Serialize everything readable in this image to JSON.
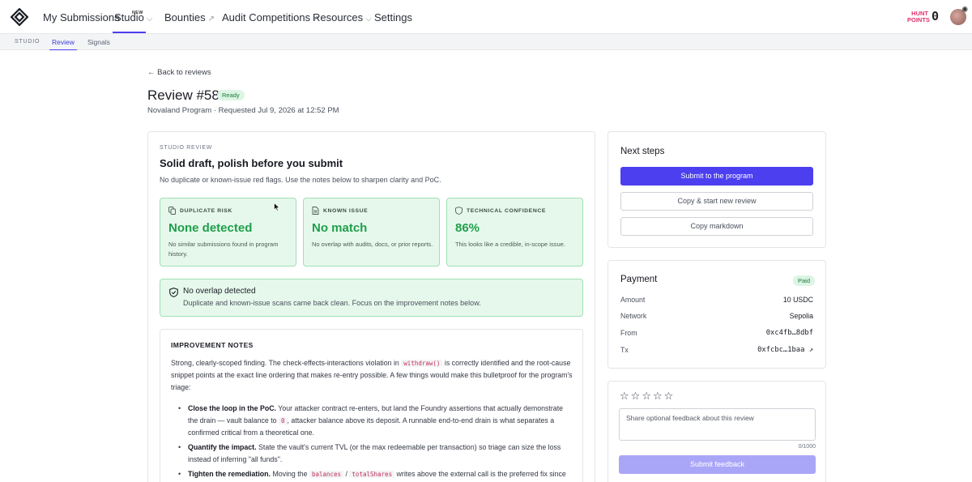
{
  "nav": {
    "items": [
      {
        "label": "My Submissions"
      },
      {
        "label": "Studio",
        "badge": "NEW"
      },
      {
        "label": "Bounties"
      },
      {
        "label": "Audit Competitions"
      },
      {
        "label": "Resources"
      },
      {
        "label": "Settings"
      }
    ],
    "hunt_points_label_1": "HUNT",
    "hunt_points_label_2": "POINTS",
    "hunt_points_value": "0"
  },
  "subnav": {
    "section": "STUDIO",
    "tabs": [
      {
        "label": "Review",
        "active": true
      },
      {
        "label": "Signals",
        "active": false
      }
    ]
  },
  "header": {
    "back_link": "Back to reviews",
    "title": "Review #58",
    "status": "Ready",
    "subtitle": "Novaland Program · Requested Jul 9, 2026 at 12:52 PM"
  },
  "review": {
    "eyebrow": "STUDIO REVIEW",
    "heading": "Solid draft, polish before you submit",
    "description": "No duplicate or known-issue red flags. Use the notes below to sharpen clarity and PoC.",
    "metrics": [
      {
        "label": "DUPLICATE RISK",
        "value": "None detected",
        "desc": "No similar submissions found in program history.",
        "icon": "copy-icon"
      },
      {
        "label": "KNOWN ISSUE",
        "value": "No match",
        "desc": "No overlap with audits, docs, or prior reports.",
        "icon": "document-icon"
      },
      {
        "label": "TECHNICAL CONFIDENCE",
        "value": "86%",
        "desc": "This looks like a credible, in-scope issue.",
        "icon": "shield-icon"
      }
    ],
    "overlap": {
      "title": "No overlap detected",
      "desc": "Duplicate and known-issue scans came back clean. Focus on the improvement notes below."
    },
    "notes": {
      "title": "IMPROVEMENT NOTES",
      "intro_1": "Strong, clearly-scoped finding. The check-effects-interactions violation in",
      "intro_code": "withdraw()",
      "intro_2": "is correctly identified and the root-cause snippet points at the exact line ordering that makes re-entry possible. A few things would make this bulletproof for the program's triage:",
      "bullets": [
        {
          "bold": "Close the loop in the PoC.",
          "text_1": "Your attacker contract re-enters, but land the Foundry assertions that actually demonstrate the drain — vault balance to",
          "code": "0",
          "text_2": ", attacker balance above its deposit. A runnable end-to-end drain is what separates a confirmed critical from a theoretical one."
        },
        {
          "bold": "Quantify the impact.",
          "text_1": "State the vault's current TVL (or the max redeemable per transaction) so triage can size the loss instead of inferring \"all funds\"."
        },
        {
          "bold": "Tighten the remediation.",
          "text_1": "Moving the",
          "code": "balances",
          "sep": "/",
          "code_2": "totalShares",
          "text_2": "writes above the external call is the preferred fix since"
        }
      ]
    }
  },
  "next_steps": {
    "title": "Next steps",
    "submit": "Submit to the program",
    "copy_new": "Copy & start new review",
    "copy_md": "Copy markdown"
  },
  "payment": {
    "title": "Payment",
    "status": "Paid",
    "rows": [
      {
        "key": "Amount",
        "value": "10 USDC"
      },
      {
        "key": "Network",
        "value": "Sepolia"
      },
      {
        "key": "From",
        "value": "0xc4fb…8dbf"
      },
      {
        "key": "Tx",
        "value": "0xfcbc…1baa ↗"
      }
    ]
  },
  "feedback": {
    "rating": 0,
    "max_rating": 5,
    "placeholder": "Share optional feedback about this review",
    "char_count": "0/1000",
    "submit": "Submit feedback"
  },
  "colors": {
    "accent": "#4b3ff0",
    "success": "#1f9f4a",
    "success_bg": "#e6f8ec",
    "brand_pink": "#e1306c"
  }
}
